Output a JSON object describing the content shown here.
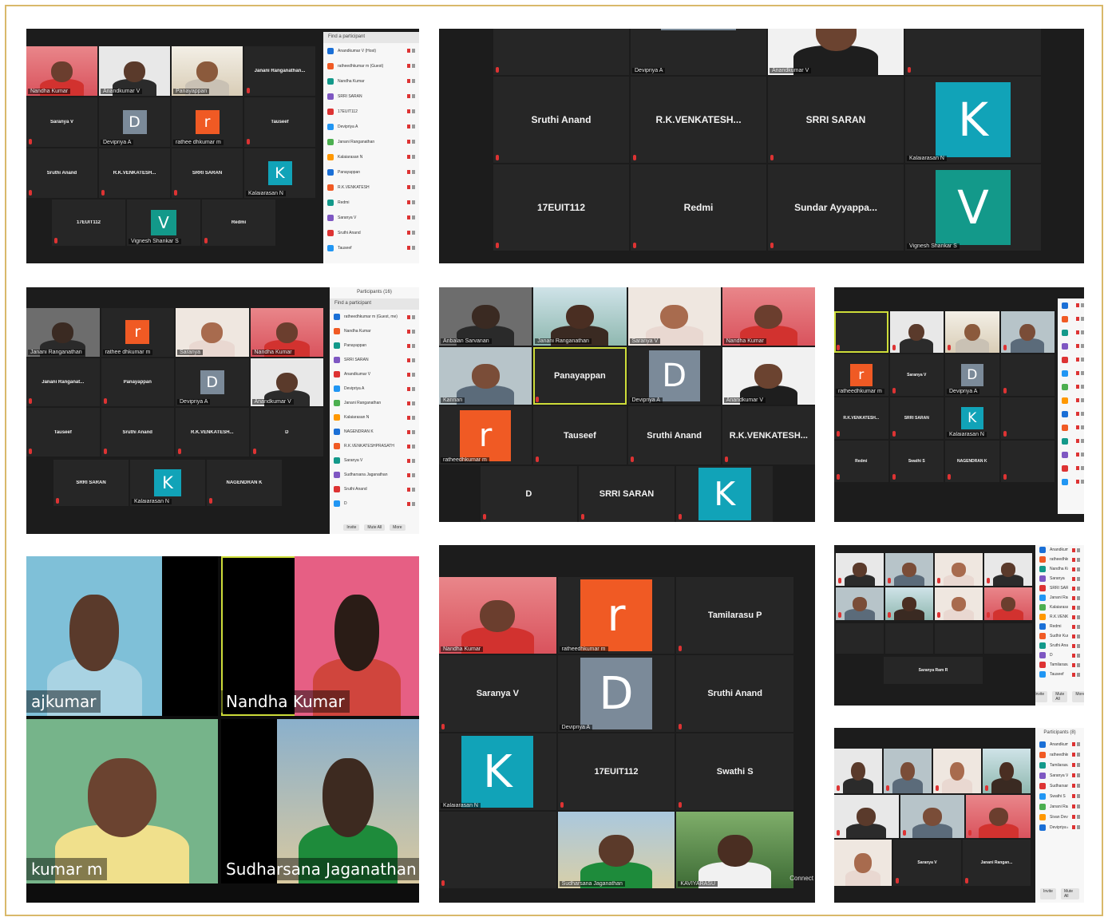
{
  "colors": {
    "frame_border": "#d9b96a",
    "tile_bg": "#262626",
    "accent_active": "#cddc39",
    "avatar_orange": "#f05a24",
    "avatar_teal": "#11a3b8",
    "avatar_grey": "#7b8a99",
    "avatar_green": "#13998a"
  },
  "s1": {
    "panel_header": "Find a participant",
    "tiles": [
      {
        "name": "",
        "cap": "Nandha Kumar",
        "kind": "cam-red",
        "active": true
      },
      {
        "name": "",
        "cap": "Anandkumar V",
        "kind": "cam-man"
      },
      {
        "name": "",
        "cap": "Panayappan",
        "kind": "cam-room"
      },
      {
        "name": "Janani Ranganathan...",
        "cap": "",
        "kind": "text"
      },
      {
        "name": "Saranya V",
        "cap": "",
        "kind": "text"
      },
      {
        "name": "",
        "cap": "Devipriya A",
        "kind": "D"
      },
      {
        "name": "",
        "cap": "rathee dhkumar m",
        "kind": "r"
      },
      {
        "name": "Tauseef",
        "cap": "",
        "kind": "text"
      },
      {
        "name": "Sruthi Anand",
        "cap": "",
        "kind": "text"
      },
      {
        "name": "R.K.VENKATESH...",
        "cap": "",
        "kind": "text"
      },
      {
        "name": "SRRI SARAN",
        "cap": "",
        "kind": "text"
      },
      {
        "name": "",
        "cap": "Kalaiarasan N",
        "kind": "K"
      }
    ],
    "row4": [
      {
        "name": "17EUIT112",
        "cap": "",
        "kind": "text"
      },
      {
        "name": "",
        "cap": "Vignesh Shankar S",
        "kind": "V"
      },
      {
        "name": "Redmi",
        "cap": "",
        "kind": "text"
      }
    ],
    "participants": [
      "Anandkumar V (Host)",
      "ratheedhkumar m (Guest)",
      "Nandha Kumar",
      "SRRI SARAN",
      "17EUIT112",
      "Devipriya A",
      "Janani Ranganathan",
      "Kalaiarasan N",
      "Panayappan",
      "R.K.VENKATESH",
      "Redmi",
      "Saranya V",
      "Sruthi Anand",
      "Tauseef"
    ]
  },
  "s2": {
    "tiles": [
      {
        "name": "",
        "cap": "",
        "kind": "text"
      },
      {
        "name": "",
        "cap": "Devipriya A",
        "kind": "D-top"
      },
      {
        "name": "",
        "cap": "Anandkumar V",
        "kind": "cam-suit"
      },
      {
        "name": "",
        "cap": "",
        "kind": "text"
      },
      {
        "name": "Sruthi Anand",
        "cap": "",
        "kind": "text"
      },
      {
        "name": "R.K.VENKATESH...",
        "cap": "",
        "kind": "text"
      },
      {
        "name": "SRRI SARAN",
        "cap": "",
        "kind": "text"
      },
      {
        "name": "",
        "cap": "Kalaiarasan N",
        "kind": "K"
      },
      {
        "name": "17EUIT112",
        "cap": "",
        "kind": "text"
      },
      {
        "name": "Redmi",
        "cap": "",
        "kind": "text"
      },
      {
        "name": "Sundar Ayyappa...",
        "cap": "",
        "kind": "text"
      },
      {
        "name": "",
        "cap": "Vignesh Shankar S",
        "kind": "V"
      }
    ]
  },
  "s3": {
    "panel_title": "Participants (16)",
    "panel_header": "Find a participant",
    "tiles": [
      {
        "name": "",
        "cap": "Janani Ranganathan",
        "kind": "cam-dark"
      },
      {
        "name": "",
        "cap": "rathee dhkumar m",
        "kind": "r"
      },
      {
        "name": "",
        "cap": "Saranya",
        "kind": "cam-woman"
      },
      {
        "name": "",
        "cap": "Nandha Kumar",
        "kind": "cam-red",
        "active": true
      },
      {
        "name": "Janani Ranganat...",
        "cap": "",
        "kind": "text"
      },
      {
        "name": "Panayappan",
        "cap": "",
        "kind": "text"
      },
      {
        "name": "",
        "cap": "Devipriya A",
        "kind": "D"
      },
      {
        "name": "",
        "cap": "Anandkumar V",
        "kind": "cam-man"
      },
      {
        "name": "Tauseef",
        "cap": "",
        "kind": "text"
      },
      {
        "name": "Sruthi Anand",
        "cap": "",
        "kind": "text"
      },
      {
        "name": "R.K.VENKATESH...",
        "cap": "",
        "kind": "text"
      },
      {
        "name": "D",
        "cap": "",
        "kind": "text"
      }
    ],
    "row4": [
      {
        "name": "SRRI SARAN",
        "cap": "",
        "kind": "text"
      },
      {
        "name": "",
        "cap": "Kalaiarasan N",
        "kind": "K"
      },
      {
        "name": "NAGENDRAN K",
        "cap": "",
        "kind": "text"
      }
    ],
    "participants": [
      "ratheedhkumar m (Guest, me)",
      "Nandha Kumar",
      "Panayappan",
      "SRRI SARAN",
      "Anandkumar V",
      "Devipriya A",
      "Janani Ranganathan",
      "Kalaiarasan N",
      "NAGENDRAN K",
      "R.K.VENKATESHPRASATH",
      "Saranya V",
      "Sudharsana Jaganathan",
      "Sruthi Anand",
      "D"
    ],
    "buttons": [
      "Invite",
      "Mute All",
      "More"
    ]
  },
  "s4": {
    "tiles": [
      {
        "name": "",
        "cap": "Anbalan Sarvanan",
        "kind": "cam-dark"
      },
      {
        "name": "",
        "cap": "Janani Ranganathan",
        "kind": "cam-woman2"
      },
      {
        "name": "",
        "cap": "Saranya V",
        "kind": "cam-woman"
      },
      {
        "name": "",
        "cap": "Nandha Kumar",
        "kind": "cam-red"
      },
      {
        "name": "",
        "cap": "Kannan",
        "kind": "cam-man2"
      },
      {
        "name": "Panayappan",
        "cap": "",
        "kind": "text",
        "active": true
      },
      {
        "name": "",
        "cap": "Devipriya A",
        "kind": "D"
      },
      {
        "name": "",
        "cap": "Anandkumar V",
        "kind": "cam-suit"
      },
      {
        "name": "",
        "cap": "ratheedhkumar m",
        "kind": "r"
      },
      {
        "name": "Tauseef",
        "cap": "",
        "kind": "text"
      },
      {
        "name": "Sruthi Anand",
        "cap": "",
        "kind": "text"
      },
      {
        "name": "R.K.VENKATESH...",
        "cap": "",
        "kind": "text"
      }
    ],
    "row4": [
      {
        "name": "D",
        "cap": "",
        "kind": "text"
      },
      {
        "name": "SRRI SARAN",
        "cap": "",
        "kind": "text"
      },
      {
        "name": "",
        "cap": "",
        "kind": "K"
      }
    ]
  },
  "s5": {
    "tiles": [
      {
        "name": "",
        "cap": "",
        "kind": "text",
        "active": true
      },
      {
        "name": "",
        "cap": "",
        "kind": "cam-man"
      },
      {
        "name": "",
        "cap": "",
        "kind": "cam-room"
      },
      {
        "name": "",
        "cap": "",
        "kind": "cam-man2"
      },
      {
        "name": "",
        "cap": "ratheedhkumar m",
        "kind": "r"
      },
      {
        "name": "Saranya V",
        "cap": "",
        "kind": "text"
      },
      {
        "name": "",
        "cap": "Devipriya A",
        "kind": "D"
      },
      {
        "name": "",
        "cap": "",
        "kind": "text"
      },
      {
        "name": "R.K.VENKATESH...",
        "cap": "",
        "kind": "text"
      },
      {
        "name": "SRRI SARAN",
        "cap": "",
        "kind": "text"
      },
      {
        "name": "",
        "cap": "Kalaiarasan N",
        "kind": "K"
      },
      {
        "name": "",
        "cap": "",
        "kind": "text"
      },
      {
        "name": "Redmi",
        "cap": "",
        "kind": "text"
      },
      {
        "name": "Swathi S",
        "cap": "",
        "kind": "text"
      },
      {
        "name": "NAGENDRAN K",
        "cap": "",
        "kind": "text"
      },
      {
        "name": "",
        "cap": "",
        "kind": "text"
      }
    ]
  },
  "s6": {
    "tl_label": "ajkumar",
    "tr_label": "Nandha Kumar",
    "bl_label": "kumar m",
    "br_label": "Sudharsana Jaganathan"
  },
  "s7": {
    "tiles": [
      {
        "name": "",
        "cap": "Nandha Kumar",
        "kind": "cam-red",
        "active": true
      },
      {
        "name": "",
        "cap": "ratheedhkumar m",
        "kind": "r"
      },
      {
        "name": "Tamilarasu P",
        "cap": "",
        "kind": "text"
      },
      {
        "name": "Saranya V",
        "cap": "",
        "kind": "text"
      },
      {
        "name": "",
        "cap": "Devipriya A",
        "kind": "D"
      },
      {
        "name": "Sruthi Anand",
        "cap": "",
        "kind": "text"
      },
      {
        "name": "",
        "cap": "Kalaiarasan N",
        "kind": "K"
      },
      {
        "name": "17EUIT112",
        "cap": "",
        "kind": "text"
      },
      {
        "name": "Swathi S",
        "cap": "",
        "kind": "text"
      },
      {
        "name": "",
        "cap": "",
        "kind": "text"
      },
      {
        "name": "",
        "cap": "Sudharsana Jaganathan",
        "kind": "cam-outdoor"
      },
      {
        "name": "",
        "cap": "KAVIYARASU",
        "kind": "cam-outdoor2"
      }
    ],
    "side_caption": "Connect"
  },
  "s8": {
    "tiles": [
      {
        "name": "",
        "cap": "",
        "kind": "cam-man"
      },
      {
        "name": "",
        "cap": "",
        "kind": "cam-man2"
      },
      {
        "name": "",
        "cap": "",
        "kind": "cam-woman"
      },
      {
        "name": "",
        "cap": "",
        "kind": "cam-man"
      },
      {
        "name": "",
        "cap": "",
        "kind": "cam-man2"
      },
      {
        "name": "",
        "cap": "",
        "kind": "cam-woman2"
      },
      {
        "name": "",
        "cap": "",
        "kind": "cam-woman"
      },
      {
        "name": "",
        "cap": "",
        "kind": "cam-red",
        "active": true
      }
    ],
    "last": "Saranya Ram R",
    "participants": [
      "Anandkumar V (Me)",
      "ratheedhkumar m (Guest)",
      "Nandha Kumar",
      "Saranya",
      "SRRI SARAN",
      "Janani Ranganathan",
      "Kalaiarasan N",
      "R.K.VENKATESHPRASATH",
      "Redmi",
      "Sudhir Kumar",
      "Sruthi Anand",
      "D",
      "Tamilarasu",
      "Tauseef"
    ],
    "buttons": [
      "Invite",
      "Mute All",
      "More"
    ]
  },
  "s9": {
    "tiles": [
      {
        "name": "",
        "cap": "",
        "kind": "cam-man"
      },
      {
        "name": "",
        "cap": "",
        "kind": "cam-man2"
      },
      {
        "name": "",
        "cap": "",
        "kind": "cam-woman"
      },
      {
        "name": "",
        "cap": "",
        "kind": "cam-woman2",
        "active": true
      },
      {
        "name": "",
        "cap": "",
        "kind": "cam-man"
      },
      {
        "name": "",
        "cap": "",
        "kind": "cam-man2"
      },
      {
        "name": "",
        "cap": "",
        "kind": "cam-red"
      },
      {
        "name": "Saranya V",
        "cap": "",
        "kind": "text"
      },
      {
        "name": "Janani Rangan...",
        "cap": "",
        "kind": "text"
      }
    ],
    "panel_title": "Participants (8)",
    "participants": [
      "Anandkumar V (Me)",
      "ratheedhkumar m (Guest)",
      "Tamilarasu P",
      "Saranya V",
      "Sudharsana Jaganathan",
      "Swathi S",
      "Janani Ranganathan",
      "Sivan Dev Rangasamy",
      "Devipriya A"
    ],
    "buttons": [
      "Invite",
      "Mute All"
    ]
  }
}
